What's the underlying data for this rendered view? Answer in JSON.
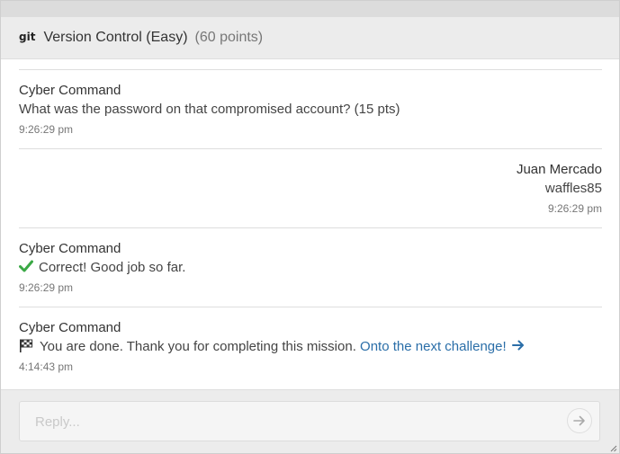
{
  "header": {
    "icon_label": "git",
    "title": "Version Control (Easy)",
    "points": "(60 points)"
  },
  "messages": [
    {
      "sender": "Cyber Command",
      "text": "What was the password on that compromised account? (15 pts)",
      "time": "9:26:29 pm"
    },
    {
      "sender": "Juan Mercado",
      "text": "waffles85",
      "time": "9:26:29 pm"
    },
    {
      "sender": "Cyber Command",
      "icon": "check-icon",
      "text": "Correct! Good job so far.",
      "time": "9:26:29 pm"
    },
    {
      "sender": "Cyber Command",
      "icon": "checkered-flag-icon",
      "text": "You are done. Thank you for completing this mission.",
      "link": "Onto the next challenge!",
      "time": "4:14:43 pm"
    }
  ],
  "reply": {
    "placeholder": "Reply..."
  },
  "colors": {
    "link": "#2a6ea8",
    "check": "#3aa845",
    "header_bg": "#ececec"
  }
}
